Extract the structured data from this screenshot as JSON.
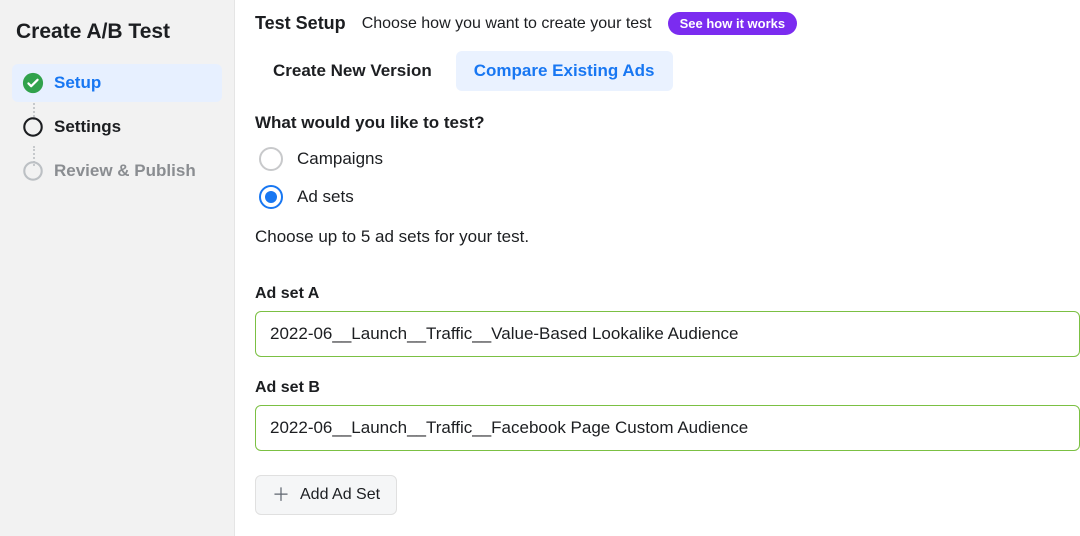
{
  "sidebar": {
    "title": "Create A/B Test",
    "steps": [
      {
        "label": "Setup",
        "state": "active"
      },
      {
        "label": "Settings",
        "state": "done"
      },
      {
        "label": "Review & Publish",
        "state": "pending"
      }
    ]
  },
  "header": {
    "title": "Test Setup",
    "subtitle": "Choose how you want to create your test",
    "pill": "See how it works"
  },
  "tabs": [
    {
      "label": "Create New Version",
      "active": false
    },
    {
      "label": "Compare Existing Ads",
      "active": true
    }
  ],
  "question": "What would you like to test?",
  "radios": [
    {
      "label": "Campaigns",
      "selected": false
    },
    {
      "label": "Ad sets",
      "selected": true
    }
  ],
  "note": "Choose up to 5 ad sets for your test.",
  "adsets": [
    {
      "label": "Ad set A",
      "value": "2022-06__Launch__Traffic__Value-Based Lookalike Audience"
    },
    {
      "label": "Ad set B",
      "value": "2022-06__Launch__Traffic__Facebook Page Custom Audience"
    }
  ],
  "addButton": "Add Ad Set"
}
